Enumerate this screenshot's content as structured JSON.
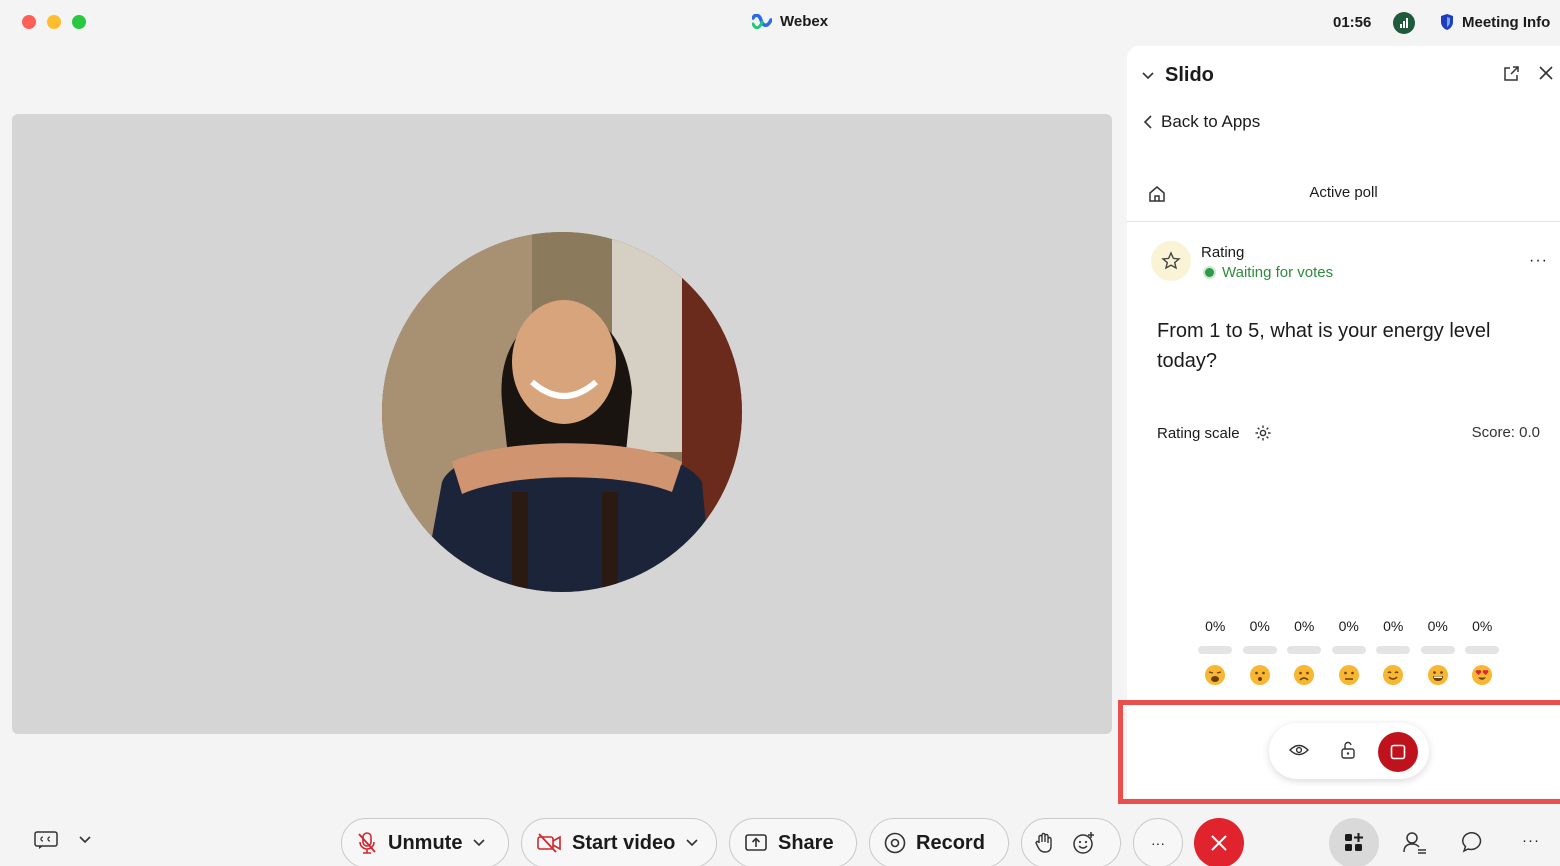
{
  "window": {
    "app_title": "Webex",
    "clock": "01:56",
    "meeting_info_label": "Meeting Info"
  },
  "slido": {
    "title": "Slido",
    "back_label": "Back to Apps",
    "subnav_title": "Active poll",
    "poll_type": "Rating",
    "poll_status": "Waiting for votes",
    "question": "From 1 to 5, what is your energy level today?",
    "scale_label": "Rating scale",
    "score": "Score: 0.0",
    "ratings": [
      {
        "pct": "0%",
        "emoji": "weary-face"
      },
      {
        "pct": "0%",
        "emoji": "hushed-face"
      },
      {
        "pct": "0%",
        "emoji": "frowning-face"
      },
      {
        "pct": "0%",
        "emoji": "neutral-face"
      },
      {
        "pct": "0%",
        "emoji": "smiling-face"
      },
      {
        "pct": "0%",
        "emoji": "grinning-face"
      },
      {
        "pct": "0%",
        "emoji": "heart-eyes-face"
      }
    ]
  },
  "controls": {
    "unmute_label": "Unmute",
    "start_video_label": "Start video",
    "share_label": "Share",
    "record_label": "Record",
    "more_label": "···"
  },
  "colors": {
    "accent_red": "#e0232c",
    "stop_red": "#c0121d",
    "highlight": "#e8504d",
    "status_green": "#2e8b3a"
  }
}
